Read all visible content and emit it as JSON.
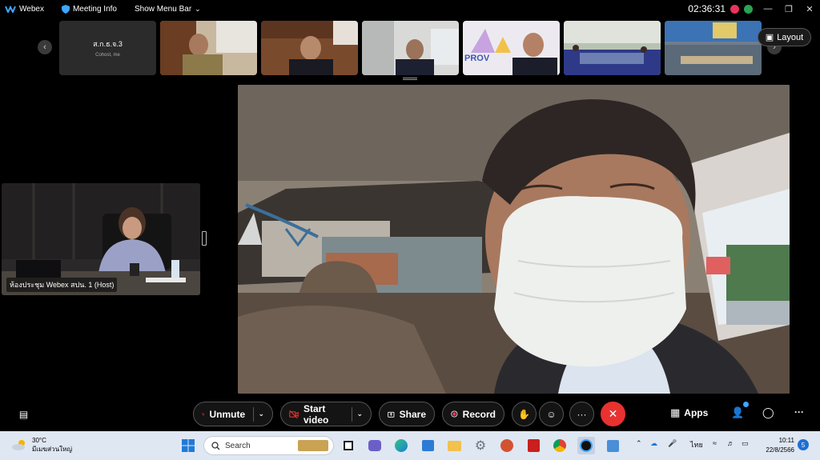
{
  "titlebar": {
    "app_name": "Webex",
    "meeting_info": "Meeting Info",
    "show_menu_bar": "Show Menu Bar",
    "clock": "02:36:31"
  },
  "strip": {
    "first_tile_name": "ส.ก.ธ.จ.3",
    "first_tile_sub": "Cohost, me",
    "layout_label": "Layout"
  },
  "small_tile": {
    "label": "ห้องประชุม Webex สปน. 1 (Host)"
  },
  "controls": {
    "unmute": "Unmute",
    "start_video": "Start video",
    "share": "Share",
    "record": "Record",
    "more": "···",
    "apps": "Apps",
    "overflow": "···"
  },
  "taskbar": {
    "temp": "30°C",
    "weather_desc": "มีเมฆส่วนใหญ่",
    "search_placeholder": "Search",
    "lang": "ไทย",
    "time": "10:11",
    "date": "22/8/2566",
    "notif_count": "5"
  },
  "colors": {
    "accent_red": "#e8322f",
    "record_red": "#e8345b",
    "taskbar_bg": "#dfe7f3"
  }
}
